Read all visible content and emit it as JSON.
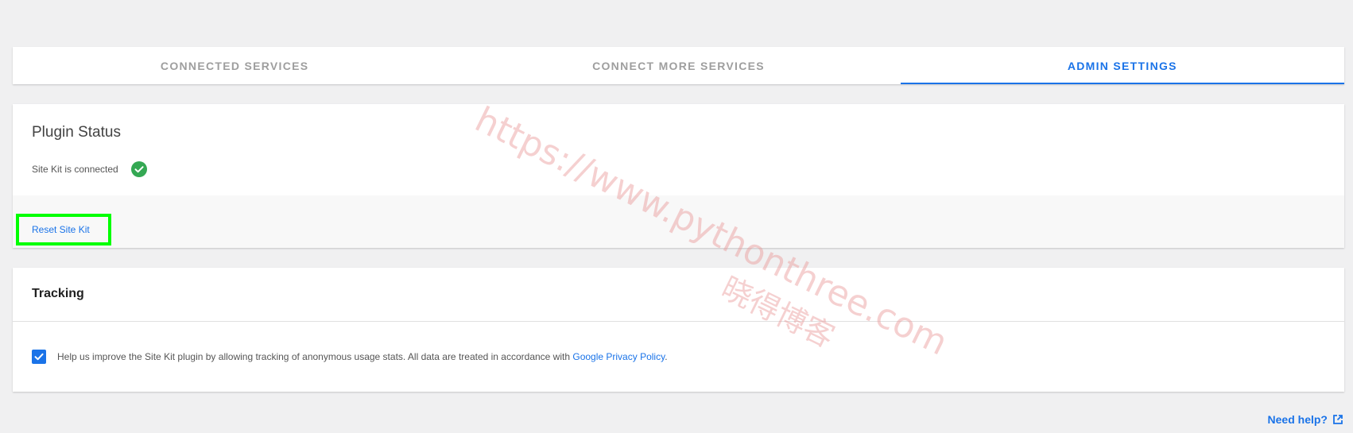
{
  "tabs": [
    {
      "label": "CONNECTED SERVICES",
      "active": false
    },
    {
      "label": "CONNECT MORE SERVICES",
      "active": false
    },
    {
      "label": "ADMIN SETTINGS",
      "active": true
    }
  ],
  "plugin_status": {
    "title": "Plugin Status",
    "connected_text": "Site Kit is connected",
    "status_icon": "check-circle-icon",
    "status_color": "#34a853",
    "reset_label": "Reset Site Kit"
  },
  "tracking": {
    "title": "Tracking",
    "checked": true,
    "text": "Help us improve the Site Kit plugin by allowing tracking of anonymous usage stats. All data are treated in accordance with ",
    "link_label": "Google Privacy Policy",
    "suffix": "."
  },
  "footer": {
    "help_label": "Need help?",
    "help_icon": "external-link-icon"
  },
  "watermark": {
    "url": "https://www.pythonthree.com",
    "cn": "晓得博客"
  },
  "colors": {
    "accent": "#1a73e8",
    "highlight": "#00ff00",
    "success": "#34a853"
  }
}
